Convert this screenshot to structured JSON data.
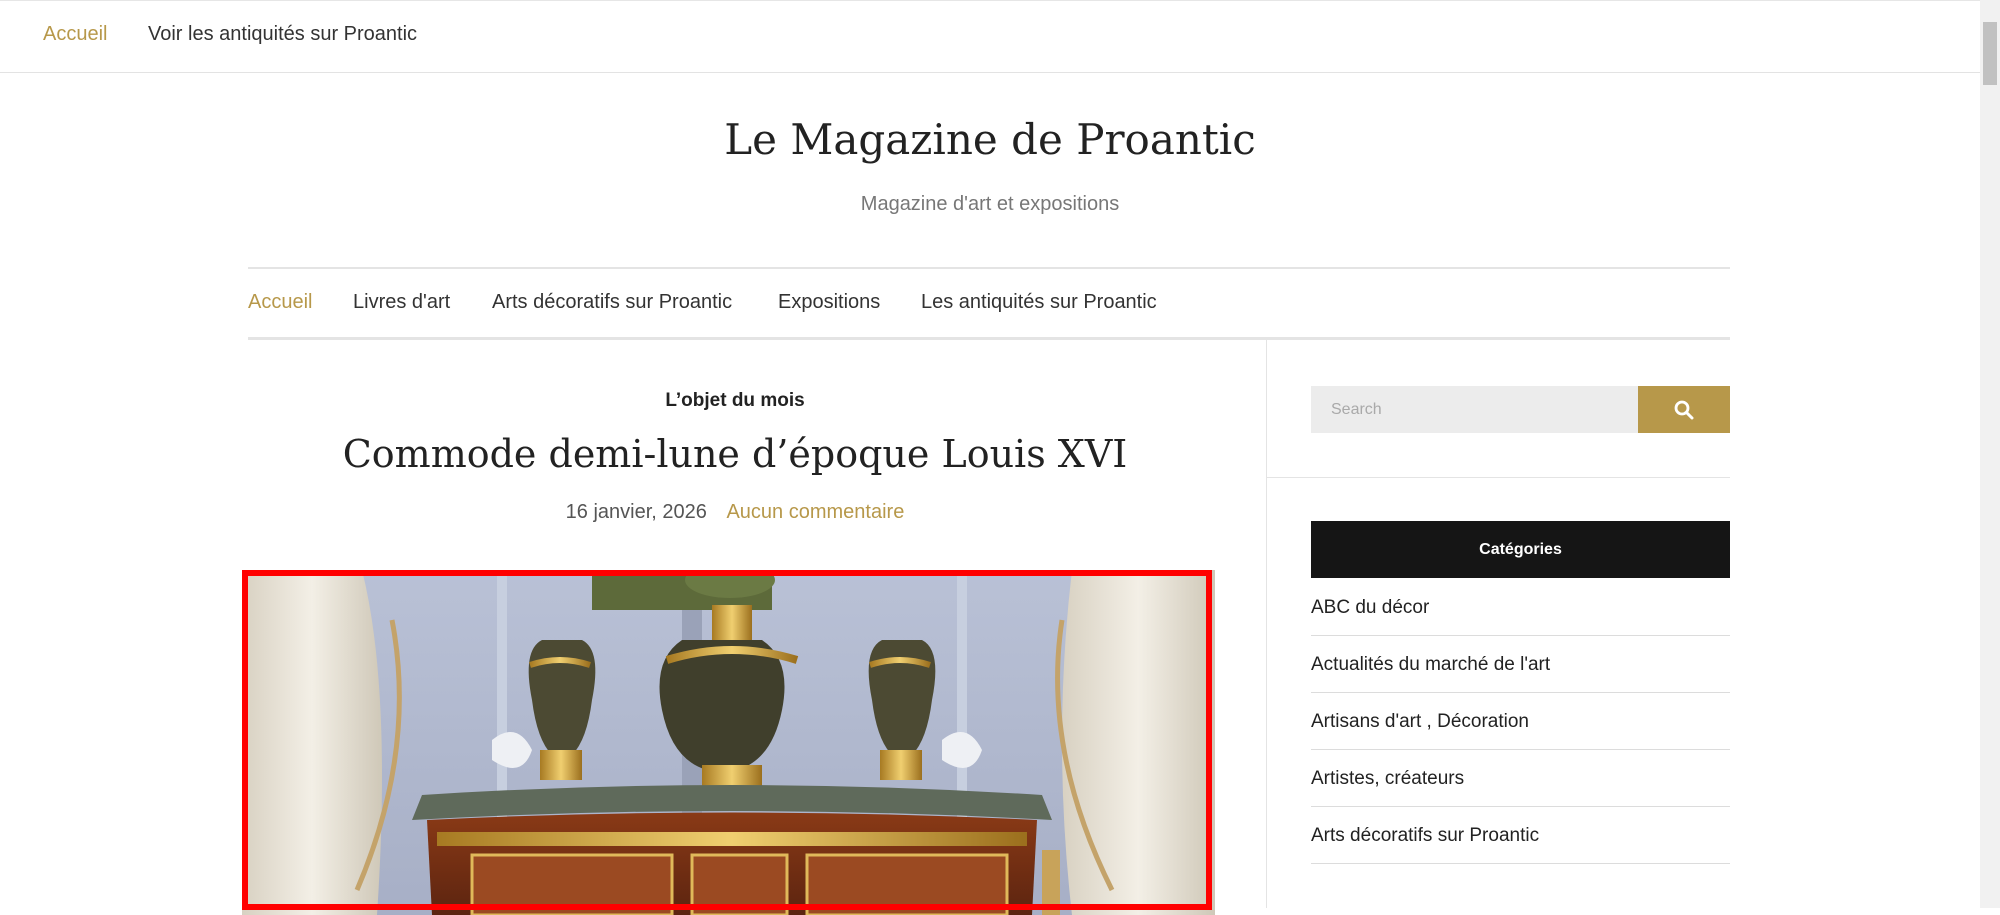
{
  "topbar": {
    "links": [
      "Accueil",
      "Voir les antiquités sur Proantic"
    ]
  },
  "site": {
    "title": "Le Magazine de Proantic",
    "description": "Magazine d'art et expositions"
  },
  "mainnav": {
    "items": [
      "Accueil",
      "Livres d'art",
      "Arts décoratifs sur Proantic",
      "Expositions",
      "Les antiquités sur Proantic"
    ]
  },
  "post": {
    "category": "L’objet du mois",
    "title": "Commode demi-lune d’époque Louis XVI",
    "date": "16 janvier, 2026",
    "comments": "Aucun commentaire"
  },
  "sidebar": {
    "search_placeholder": "Search",
    "search_icon": "search-icon",
    "categories_title": "Catégories",
    "categories": [
      "ABC du décor",
      "Actualités du marché de l'art",
      "Artisans d'art , Décoration",
      "Artistes, créateurs",
      "Arts décoratifs sur Proantic"
    ]
  },
  "colors": {
    "accent": "#b7984a",
    "dark": "#151515",
    "highlight": "#ff0000"
  }
}
